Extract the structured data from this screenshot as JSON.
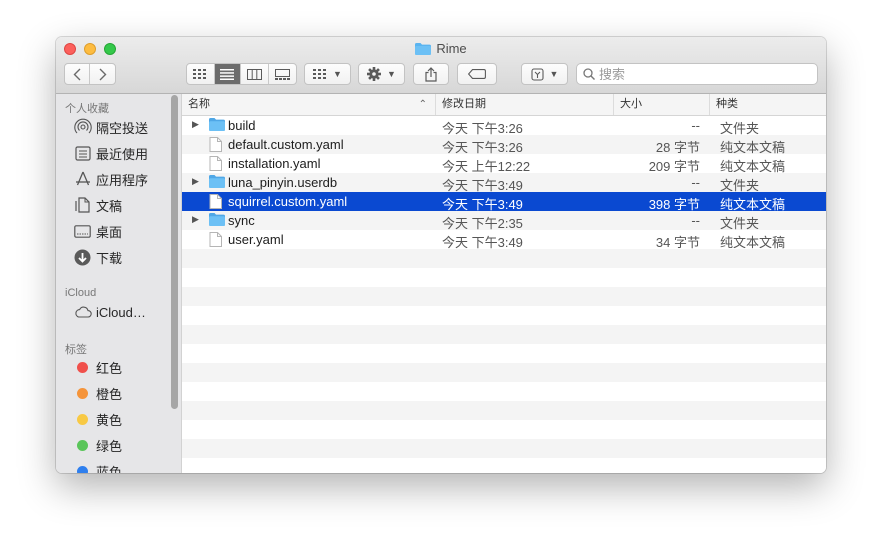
{
  "window": {
    "title": "Rime"
  },
  "search": {
    "placeholder": "搜索"
  },
  "sidebar": {
    "favorites_header": "个人收藏",
    "favorites": [
      {
        "label": "隔空投送",
        "icon": "airdrop-icon"
      },
      {
        "label": "最近使用",
        "icon": "recents-icon"
      },
      {
        "label": "应用程序",
        "icon": "applications-icon"
      },
      {
        "label": "文稿",
        "icon": "documents-icon"
      },
      {
        "label": "桌面",
        "icon": "desktop-icon"
      },
      {
        "label": "下载",
        "icon": "downloads-icon"
      }
    ],
    "icloud_header": "iCloud",
    "icloud": [
      {
        "label": "iCloud…",
        "icon": "cloud-icon"
      }
    ],
    "tags_header": "标签",
    "tags": [
      {
        "label": "红色",
        "color": "#f0504b"
      },
      {
        "label": "橙色",
        "color": "#f5943a"
      },
      {
        "label": "黄色",
        "color": "#f8c944"
      },
      {
        "label": "绿色",
        "color": "#5ac55a"
      },
      {
        "label": "蓝色",
        "color": "#2f7fee"
      }
    ]
  },
  "columns": {
    "name": "名称",
    "date": "修改日期",
    "size": "大小",
    "kind": "种类"
  },
  "files": [
    {
      "name": "build",
      "date": "今天 下午3:26",
      "size": "--",
      "kind": "文件夹",
      "type": "folder",
      "selected": false
    },
    {
      "name": "default.custom.yaml",
      "date": "今天 下午3:26",
      "size": "28 字节",
      "kind": "纯文本文稿",
      "type": "file",
      "selected": false
    },
    {
      "name": "installation.yaml",
      "date": "今天 上午12:22",
      "size": "209 字节",
      "kind": "纯文本文稿",
      "type": "file",
      "selected": false
    },
    {
      "name": "luna_pinyin.userdb",
      "date": "今天 下午3:49",
      "size": "--",
      "kind": "文件夹",
      "type": "folder",
      "selected": false
    },
    {
      "name": "squirrel.custom.yaml",
      "date": "今天 下午3:49",
      "size": "398 字节",
      "kind": "纯文本文稿",
      "type": "file",
      "selected": true
    },
    {
      "name": "sync",
      "date": "今天 下午2:35",
      "size": "--",
      "kind": "文件夹",
      "type": "folder",
      "selected": false
    },
    {
      "name": "user.yaml",
      "date": "今天 下午3:49",
      "size": "34 字节",
      "kind": "纯文本文稿",
      "type": "file",
      "selected": false
    }
  ],
  "colors": {
    "selection": "#0a49d1",
    "folder": "#5ab4f0"
  }
}
